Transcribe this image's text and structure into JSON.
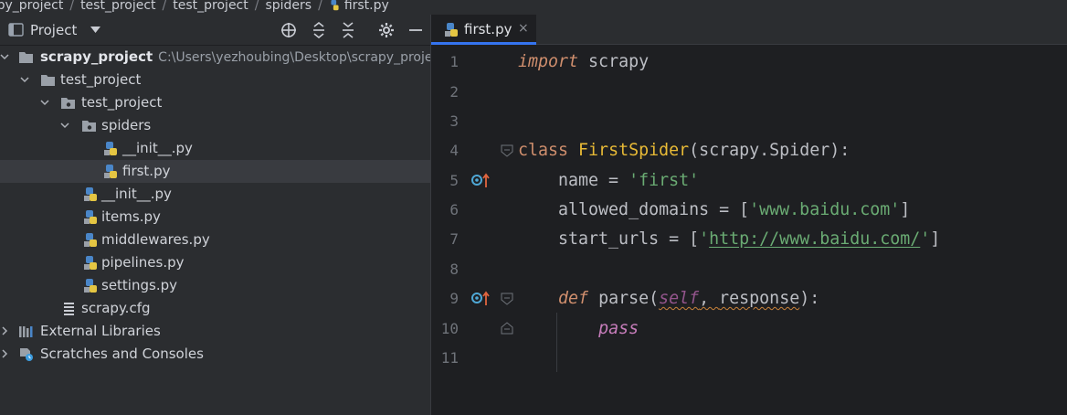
{
  "breadcrumb": {
    "items": [
      "apy_project",
      "test_project",
      "test_project",
      "spiders",
      "first.py"
    ]
  },
  "project_panel": {
    "title": "Project",
    "tree": [
      {
        "label": "scrapy_project",
        "path": "C:\\Users\\yezhoubing\\Desktop\\scrapy_proje",
        "type": "project-folder",
        "expanded": true
      },
      {
        "label": "test_project",
        "type": "folder",
        "expanded": true
      },
      {
        "label": "test_project",
        "type": "package",
        "expanded": true
      },
      {
        "label": "spiders",
        "type": "package",
        "expanded": true
      },
      {
        "label": "__init__.py",
        "type": "python-file"
      },
      {
        "label": "first.py",
        "type": "python-file",
        "selected": true
      },
      {
        "label": "__init__.py",
        "type": "python-file"
      },
      {
        "label": "items.py",
        "type": "python-file"
      },
      {
        "label": "middlewares.py",
        "type": "python-file"
      },
      {
        "label": "pipelines.py",
        "type": "python-file"
      },
      {
        "label": "settings.py",
        "type": "python-file"
      },
      {
        "label": "scrapy.cfg",
        "type": "config-file"
      },
      {
        "label": "External Libraries",
        "type": "libraries",
        "expanded": false
      },
      {
        "label": "Scratches and Consoles",
        "type": "scratches",
        "expanded": false
      }
    ]
  },
  "editor": {
    "tab": {
      "label": "first.py",
      "close": "×"
    },
    "line_numbers": [
      "1",
      "2",
      "3",
      "4",
      "5",
      "6",
      "7",
      "8",
      "9",
      "10",
      "11"
    ],
    "code": {
      "l1_kw": "import",
      "l1_rest": " scrapy",
      "l4_kw": "class",
      "l4_cls": "FirstSpider",
      "l4_rest": "(scrapy.Spider):",
      "l5_a": "    name = ",
      "l5_str": "'first'",
      "l6_a": "    allowed_domains = [",
      "l6_str": "'www.baidu.com'",
      "l6_b": "]",
      "l7_a": "    start_urls = [",
      "l7_q1": "'",
      "l7_url": "http://www.baidu.com/",
      "l7_q2": "'",
      "l7_b": "]",
      "l9_kw": "def",
      "l9_name": " parse(",
      "l9_self": "self",
      "l9_comma": ", ",
      "l9_param": "response",
      "l9_end": "):",
      "l10_kw": "pass"
    }
  },
  "colors": {
    "accent": "#3574f0",
    "keyword": "#cf8e6d",
    "string": "#6aab73",
    "class_name": "#e8ba36",
    "self": "#94558d",
    "pass": "#c77dbb"
  }
}
